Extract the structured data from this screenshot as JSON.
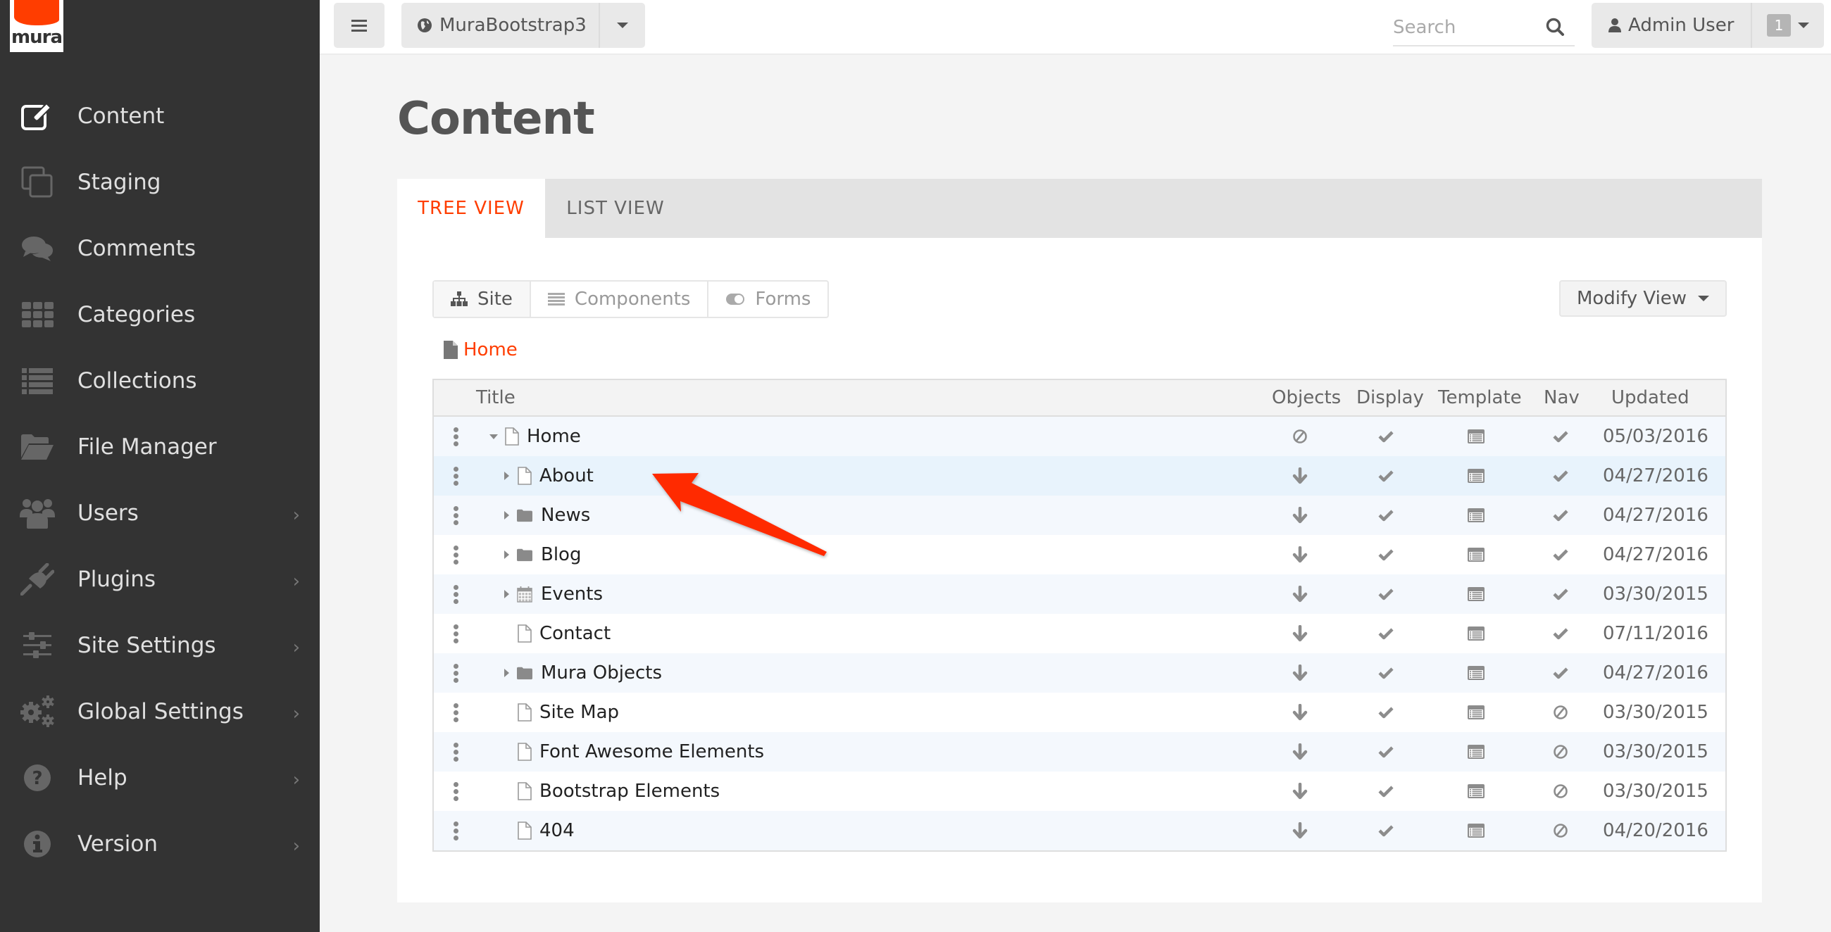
{
  "app": {
    "logo_text": "mura",
    "brand_color": "#ff3d00"
  },
  "sidebar": {
    "items": [
      {
        "label": "Content",
        "icon": "edit-icon",
        "active": true,
        "has_submenu": false
      },
      {
        "label": "Staging",
        "icon": "clone-icon",
        "has_submenu": false
      },
      {
        "label": "Comments",
        "icon": "comments-icon",
        "has_submenu": false
      },
      {
        "label": "Categories",
        "icon": "grid-icon",
        "has_submenu": false
      },
      {
        "label": "Collections",
        "icon": "list-icon",
        "has_submenu": false
      },
      {
        "label": "File Manager",
        "icon": "folder-open-icon",
        "has_submenu": false
      },
      {
        "label": "Users",
        "icon": "users-icon",
        "has_submenu": true
      },
      {
        "label": "Plugins",
        "icon": "plug-icon",
        "has_submenu": true
      },
      {
        "label": "Site Settings",
        "icon": "sliders-icon",
        "has_submenu": true
      },
      {
        "label": "Global Settings",
        "icon": "cogs-icon",
        "has_submenu": true
      },
      {
        "label": "Help",
        "icon": "question-circle-icon",
        "has_submenu": true
      },
      {
        "label": "Version",
        "icon": "info-circle-icon",
        "has_submenu": true
      }
    ]
  },
  "topbar": {
    "site_name": "MuraBootstrap3",
    "search_placeholder": "Search",
    "search_value": "",
    "user_name": "Admin User",
    "notification_count": "1"
  },
  "page": {
    "title": "Content",
    "tabs": [
      {
        "label": "TREE VIEW",
        "active": true
      },
      {
        "label": "LIST VIEW",
        "active": false
      }
    ],
    "segments": [
      {
        "label": "Site",
        "icon": "sitemap-icon",
        "active": true
      },
      {
        "label": "Components",
        "icon": "list-icon",
        "active": false
      },
      {
        "label": "Forms",
        "icon": "toggle-icon",
        "active": false
      }
    ],
    "modify_view_label": "Modify View",
    "breadcrumb": "Home"
  },
  "table": {
    "columns": [
      "Title",
      "Objects",
      "Display",
      "Template",
      "Nav",
      "Updated"
    ],
    "rows": [
      {
        "title": "Home",
        "type": "page",
        "level": 0,
        "toggle": "expanded",
        "objects": "none",
        "display": "check",
        "template": "template",
        "nav": "check",
        "updated": "05/03/2016"
      },
      {
        "title": "About",
        "type": "page",
        "level": 1,
        "toggle": "collapsed",
        "objects": "inherit",
        "display": "check",
        "template": "template",
        "nav": "check",
        "updated": "04/27/2016",
        "highlighted": true
      },
      {
        "title": "News",
        "type": "folder",
        "level": 1,
        "toggle": "collapsed",
        "objects": "inherit",
        "display": "check",
        "template": "template",
        "nav": "check",
        "updated": "04/27/2016"
      },
      {
        "title": "Blog",
        "type": "folder",
        "level": 1,
        "toggle": "collapsed",
        "objects": "inherit",
        "display": "check",
        "template": "template",
        "nav": "check",
        "updated": "04/27/2016"
      },
      {
        "title": "Events",
        "type": "calendar",
        "level": 1,
        "toggle": "collapsed",
        "objects": "inherit",
        "display": "check",
        "template": "template",
        "nav": "check",
        "updated": "03/30/2015"
      },
      {
        "title": "Contact",
        "type": "page",
        "level": 1,
        "toggle": "none",
        "objects": "inherit",
        "display": "check",
        "template": "template",
        "nav": "check",
        "updated": "07/11/2016"
      },
      {
        "title": "Mura Objects",
        "type": "folder",
        "level": 1,
        "toggle": "collapsed",
        "objects": "inherit",
        "display": "check",
        "template": "template",
        "nav": "check",
        "updated": "04/27/2016"
      },
      {
        "title": "Site Map",
        "type": "page",
        "level": 1,
        "toggle": "none",
        "objects": "inherit",
        "display": "check",
        "template": "template",
        "nav": "none",
        "updated": "03/30/2015"
      },
      {
        "title": "Font Awesome Elements",
        "type": "page",
        "level": 1,
        "toggle": "none",
        "objects": "inherit",
        "display": "check",
        "template": "template",
        "nav": "none",
        "updated": "03/30/2015"
      },
      {
        "title": "Bootstrap Elements",
        "type": "page",
        "level": 1,
        "toggle": "none",
        "objects": "inherit",
        "display": "check",
        "template": "template",
        "nav": "none",
        "updated": "03/30/2015"
      },
      {
        "title": "404",
        "type": "page",
        "level": 1,
        "toggle": "none",
        "objects": "inherit",
        "display": "check",
        "template": "template",
        "nav": "none",
        "updated": "04/20/2016"
      }
    ]
  },
  "annotation": {
    "type": "arrow",
    "color": "#ff2a00",
    "points_to": "About"
  }
}
